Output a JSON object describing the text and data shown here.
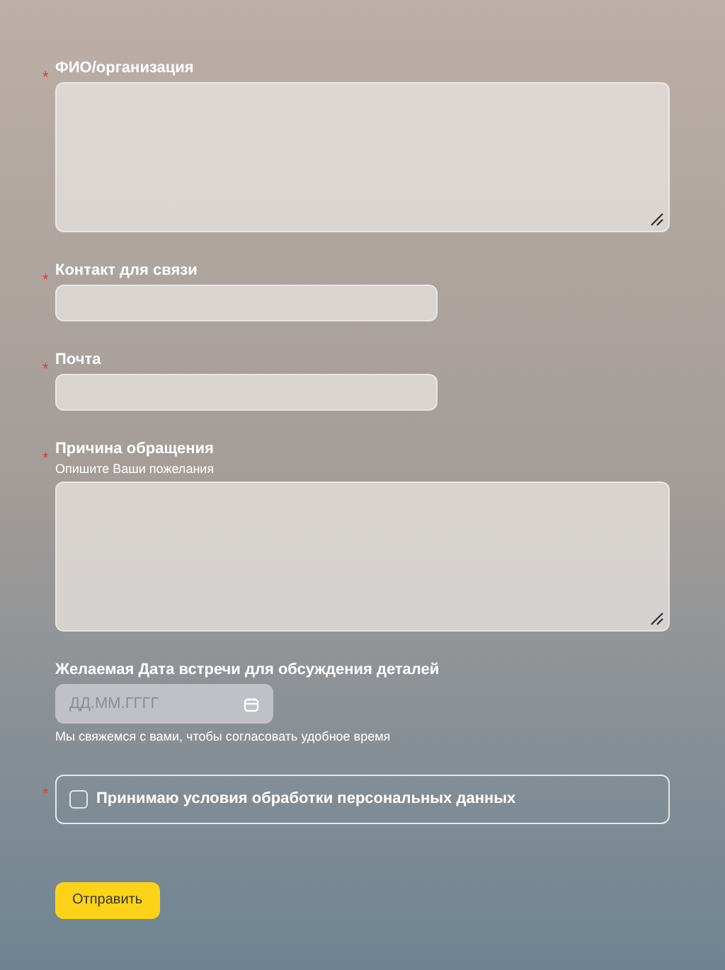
{
  "fields": [
    {
      "kind": "textarea",
      "label": "ФИО/организация",
      "required_mark": "*"
    },
    {
      "kind": "input",
      "label": "Контакт для связи",
      "required_mark": "*"
    },
    {
      "kind": "input",
      "label": "Почта",
      "required_mark": "*"
    },
    {
      "kind": "textarea",
      "label": "Причина обращения",
      "required_mark": "*",
      "hint": "Опишите Ваши пожелания"
    },
    {
      "kind": "date",
      "label": "Желаемая Дата встречи для обсуждения деталей",
      "placeholder": "ДД.ММ.ГГГГ",
      "note": "Мы свяжемся с вами, чтобы согласовать удобное время"
    }
  ],
  "consent": {
    "label": "Принимаю условия обработки персональных данных",
    "checked": false,
    "required_mark": "*"
  },
  "submit": "Отправить"
}
